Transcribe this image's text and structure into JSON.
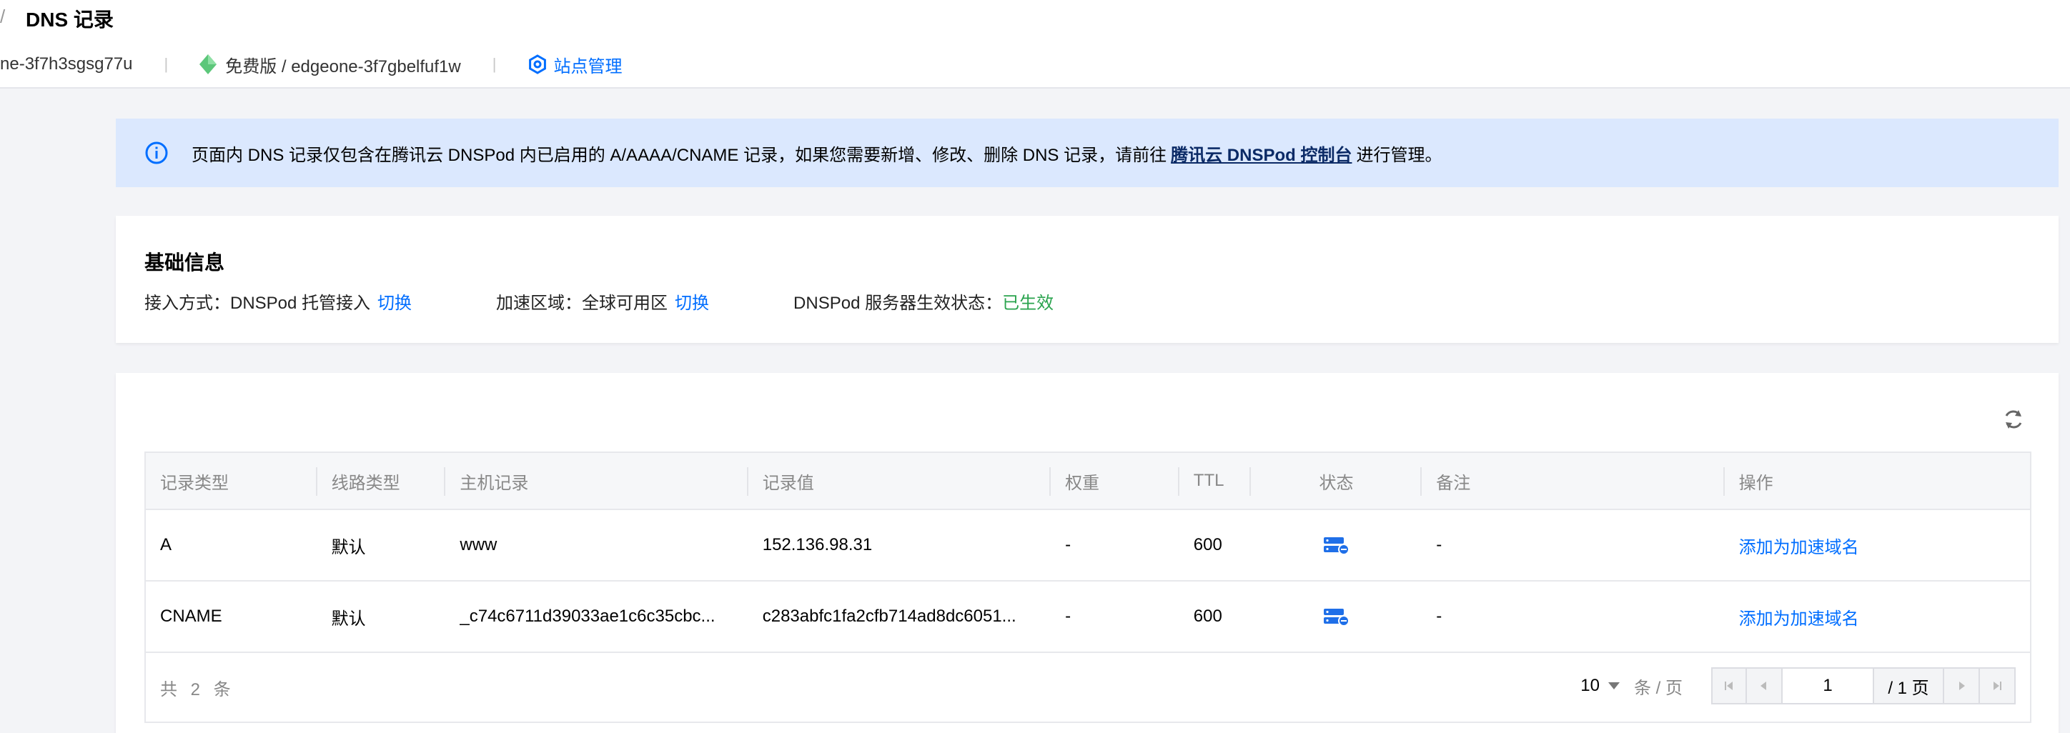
{
  "header": {
    "slash": "/",
    "title": "DNS 记录",
    "site_id": "ne-3f7h3sgsg77u",
    "plan_label": "免费版 / edgeone-3f7gbelfuf1w",
    "site_manage_label": "站点管理"
  },
  "notice": {
    "text_before": "页面内 DNS 记录仅包含在腾讯云 DNSPod 内已启用的 A/AAAA/CNAME 记录，如果您需要新增、修改、删除 DNS 记录，请前往",
    "link_text": "腾讯云 DNSPod 控制台",
    "text_after": "进行管理。"
  },
  "basic": {
    "title": "基础信息",
    "access_label": "接入方式：DNSPod 托管接入",
    "access_switch": "切换",
    "region_label": "加速区域：全球可用区",
    "region_switch": "切换",
    "status_label": "DNSPod 服务器生效状态：",
    "status_value": "已生效"
  },
  "table": {
    "headers": [
      "记录类型",
      "线路类型",
      "主机记录",
      "记录值",
      "权重",
      "TTL",
      "状态",
      "备注",
      "操作"
    ],
    "rows": [
      {
        "type": "A",
        "line": "默认",
        "host": "www",
        "value": "152.136.98.31",
        "weight": "-",
        "ttl": "600",
        "status_icon": "server-status-icon",
        "remark": "-",
        "action": "添加为加速域名"
      },
      {
        "type": "CNAME",
        "line": "默认",
        "host": "_c74c6711d39033ae1c6c35cbc...",
        "value": "c283abfc1fa2cfb714ad8dc6051...",
        "weight": "-",
        "ttl": "600",
        "status_icon": "server-status-icon",
        "remark": "-",
        "action": "添加为加速域名"
      }
    ],
    "total": "共 2 条",
    "page_size": "10",
    "page_size_unit": "条 / 页",
    "current_page": "1",
    "page_count": "/ 1 页"
  },
  "colors": {
    "accent": "#006eff",
    "success": "#29a34d",
    "notice_bg": "#dbe8fe"
  }
}
